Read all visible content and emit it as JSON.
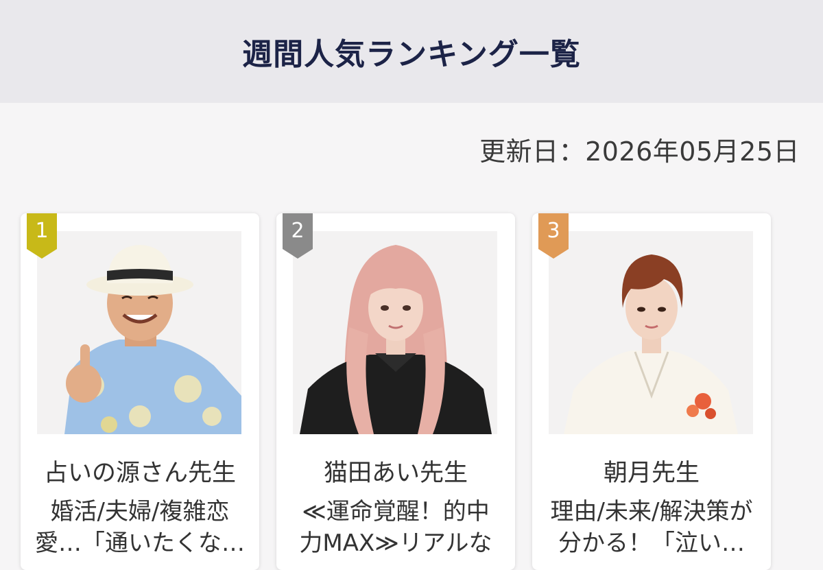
{
  "header": {
    "title": "週間人気ランキング一覧"
  },
  "updated": {
    "text": "更新日：2026年05月25日"
  },
  "colors": {
    "rank1": "#c8b918",
    "rank2": "#8a8a8a",
    "rank3": "#e09a56",
    "title": "#1c2347"
  },
  "rankings": [
    {
      "rank": "1",
      "name": "占いの源さん先生",
      "catch_line1": "婚活/夫婦/複雑恋",
      "catch_line2": "愛…「通いたくな…",
      "photo_icon": "fortune-teller-photo-man-hat"
    },
    {
      "rank": "2",
      "name": "猫田あい先生",
      "catch_line1": "≪運命覚醒！的中",
      "catch_line2": "力MAX≫リアルな",
      "photo_icon": "fortune-teller-photo-woman-pink-hair"
    },
    {
      "rank": "3",
      "name": "朝月先生",
      "catch_line1": "理由/未来/解決策が",
      "catch_line2": "分かる！「泣い…",
      "photo_icon": "fortune-teller-photo-woman-kimono"
    }
  ]
}
